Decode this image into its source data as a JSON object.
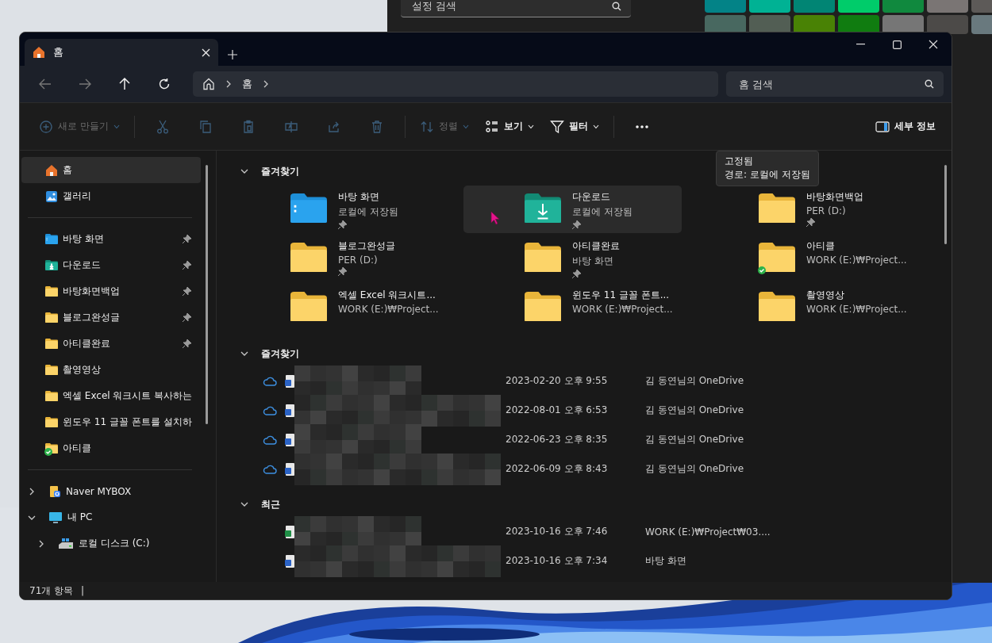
{
  "settings_window": {
    "search": {
      "placeholder": "설정 검색"
    },
    "accent_swatches": [
      {
        "color": "#038387"
      },
      {
        "color": "#00b294"
      },
      {
        "color": "#018574"
      },
      {
        "color": "#00cc6a"
      },
      {
        "color": "#10893e"
      },
      {
        "color": "#7a7574"
      },
      {
        "color": "#5d5a58"
      },
      {
        "color": "#486860"
      },
      {
        "color": "#525e54"
      },
      {
        "color": "#498205"
      },
      {
        "color": "#107c10"
      },
      {
        "color": "#767676"
      },
      {
        "color": "#4c4a48"
      },
      {
        "color": "#69797e"
      }
    ]
  },
  "window": {
    "tabs": [
      {
        "label": "홈",
        "selected": true
      }
    ]
  },
  "address_bar": {
    "path": [
      "홈"
    ]
  },
  "search": {
    "placeholder": "홈 검색"
  },
  "toolbar": {
    "items": [
      {
        "kind": "new",
        "label": "새로 만들기",
        "disabled": true
      },
      {
        "kind": "cut",
        "disabled": true
      },
      {
        "kind": "copy",
        "disabled": true
      },
      {
        "kind": "paste",
        "disabled": true
      },
      {
        "kind": "rename",
        "disabled": true
      },
      {
        "kind": "share",
        "disabled": true
      },
      {
        "kind": "delete",
        "disabled": true
      },
      {
        "kind": "sort",
        "label": "정렬",
        "disabled": true
      },
      {
        "kind": "view",
        "label": "보기",
        "disabled": false
      },
      {
        "kind": "filter",
        "label": "필터",
        "disabled": false
      },
      {
        "kind": "more",
        "disabled": false
      }
    ],
    "details": {
      "label": "세부 정보"
    }
  },
  "sidebar": {
    "top": [
      {
        "kind": "home",
        "label": "홈",
        "selected": true
      },
      {
        "kind": "gallery",
        "label": "갤러리",
        "selected": false
      }
    ],
    "pinned": [
      {
        "kind": "desktop",
        "label": "바탕 화면",
        "pinned": true,
        "synced": false,
        "selected": false
      },
      {
        "kind": "download",
        "label": "다운로드",
        "pinned": true,
        "synced": false,
        "selected": false
      },
      {
        "kind": "folder",
        "label": "바탕화면백업",
        "pinned": true,
        "synced": false,
        "selected": false
      },
      {
        "kind": "folder",
        "label": "블로그완성글",
        "pinned": true,
        "synced": false,
        "selected": false
      },
      {
        "kind": "folder",
        "label": "아티클완료",
        "pinned": true,
        "synced": false,
        "selected": false
      },
      {
        "kind": "folder",
        "label": "촬영영상",
        "pinned": false,
        "synced": false,
        "selected": false
      },
      {
        "kind": "folder",
        "label": "엑셀 Excel 워크시트 복사하는",
        "pinned": false,
        "synced": false,
        "selected": false
      },
      {
        "kind": "folder",
        "label": "윈도우 11 글꼴 폰트를 설치하",
        "pinned": false,
        "synced": false,
        "selected": false
      },
      {
        "kind": "folder",
        "label": "아티클",
        "pinned": false,
        "synced": true,
        "selected": false
      }
    ],
    "tree": [
      {
        "kind": "cloud-drive",
        "label": "Naver MYBOX",
        "expanded": false,
        "selected": false
      },
      {
        "kind": "pc",
        "label": "내 PC",
        "expanded": true,
        "selected": false,
        "children": [
          {
            "kind": "disk",
            "label": "로컬 디스크 (C:)",
            "expanded": false,
            "selected": false
          }
        ]
      }
    ]
  },
  "quick_access": {
    "title": "즐겨찾기",
    "expanded": true,
    "tiles": [
      {
        "kind": "desktop",
        "name": "바탕 화면",
        "location": "로컬에 저장됨",
        "pinned": true,
        "synced": false,
        "hovered": false
      },
      {
        "kind": "download",
        "name": "다운로드",
        "location": "로컬에 저장됨",
        "pinned": true,
        "synced": false,
        "hovered": true
      },
      {
        "kind": "folder",
        "name": "바탕화면백업",
        "location": "PER (D:)",
        "pinned": true,
        "synced": false,
        "hovered": false
      },
      {
        "kind": "folder",
        "name": "블로그완성글",
        "location": "PER (D:)",
        "pinned": true,
        "synced": false,
        "hovered": false
      },
      {
        "kind": "folder",
        "name": "아티클완료",
        "location": "바탕 화면",
        "pinned": true,
        "synced": false,
        "hovered": false
      },
      {
        "kind": "folder",
        "name": "아티클",
        "location": "WORK (E:)₩Project...",
        "pinned": false,
        "synced": true,
        "hovered": false
      },
      {
        "kind": "folder",
        "name": "엑셀 Excel 워크시트...",
        "location": "WORK (E:)₩Project...",
        "pinned": false,
        "synced": false,
        "hovered": false
      },
      {
        "kind": "folder",
        "name": "윈도우 11 글꼴 폰트...",
        "location": "WORK (E:)₩Project...",
        "pinned": false,
        "synced": false,
        "hovered": false
      },
      {
        "kind": "folder",
        "name": "촬영영상",
        "location": "WORK (E:)₩Project...",
        "pinned": false,
        "synced": false,
        "hovered": false
      }
    ]
  },
  "favorites": {
    "title": "즐겨찾기",
    "expanded": true,
    "rows": [
      {
        "cloud": true,
        "synced": false,
        "date": "2023-02-20 오후 9:55",
        "location": "김 동연님의 OneDrive"
      },
      {
        "cloud": true,
        "synced": false,
        "date": "2022-08-01 오후 6:53",
        "location": "김 동연님의 OneDrive"
      },
      {
        "cloud": true,
        "synced": false,
        "date": "2022-06-23 오후 8:35",
        "location": "김 동연님의 OneDrive"
      },
      {
        "cloud": true,
        "synced": false,
        "date": "2022-06-09 오후 8:43",
        "location": "김 동연님의 OneDrive"
      }
    ]
  },
  "recent": {
    "title": "최근",
    "expanded": true,
    "rows": [
      {
        "cloud": false,
        "synced": true,
        "date": "2023-10-16 오후 7:46",
        "location": "WORK (E:)₩Project₩03...."
      },
      {
        "cloud": false,
        "synced": false,
        "date": "2023-10-16 오후 7:34",
        "location": "바탕 화면"
      }
    ]
  },
  "tooltip": {
    "lines": [
      "고정됨",
      "경로: 로컬에 저장됨"
    ]
  },
  "status_bar": {
    "count": "71개 항목",
    "separator": "|"
  }
}
